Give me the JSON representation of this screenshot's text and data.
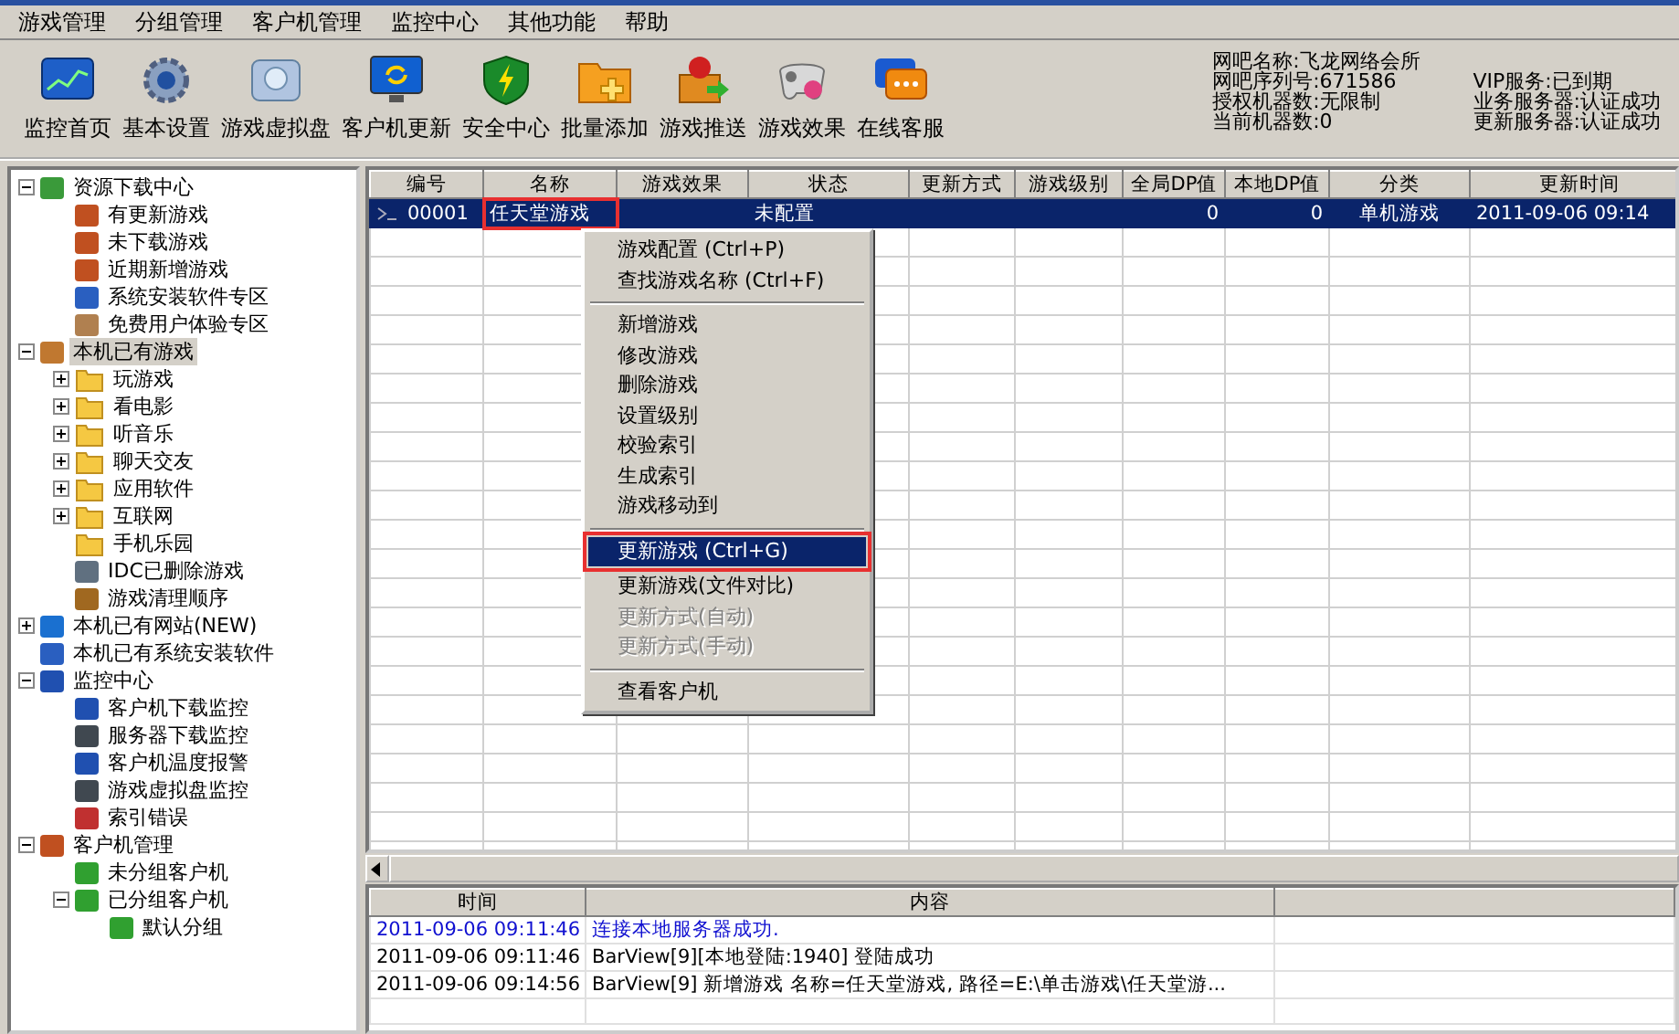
{
  "menu_bar": [
    "游戏管理",
    "分组管理",
    "客户机管理",
    "监控中心",
    "其他功能",
    "帮助"
  ],
  "toolbar": [
    {
      "label": "监控首页"
    },
    {
      "label": "基本设置"
    },
    {
      "label": "游戏虚拟盘"
    },
    {
      "label": "客户机更新"
    },
    {
      "label": "安全中心"
    },
    {
      "label": "批量添加"
    },
    {
      "label": "游戏推送"
    },
    {
      "label": "游戏效果"
    },
    {
      "label": "在线客服"
    }
  ],
  "info_left": [
    "网吧名称:飞龙网络会所",
    "网吧序列号:671586",
    "授权机器数:无限制",
    "当前机器数:0"
  ],
  "info_right": [
    "VIP服务:已到期",
    "业务服务器:认证成功",
    "更新服务器:认证成功"
  ],
  "tree": [
    {
      "label": "资源下载中心",
      "kind": "download",
      "expanded": true,
      "selected": false,
      "children": [
        {
          "label": "有更新游戏",
          "kind": "person",
          "selected": false
        },
        {
          "label": "未下载游戏",
          "kind": "person",
          "selected": false
        },
        {
          "label": "近期新增游戏",
          "kind": "person",
          "selected": false
        },
        {
          "label": "系统安装软件专区",
          "kind": "windows",
          "selected": false
        },
        {
          "label": "免费用户体验专区",
          "kind": "chair",
          "selected": false
        }
      ]
    },
    {
      "label": "本机已有游戏",
      "kind": "box",
      "expanded": true,
      "selected": true,
      "children": [
        {
          "label": "玩游戏",
          "kind": "folder",
          "expanded": false,
          "selected": false
        },
        {
          "label": "看电影",
          "kind": "folder",
          "expanded": false,
          "selected": false
        },
        {
          "label": "听音乐",
          "kind": "folder",
          "expanded": false,
          "selected": false
        },
        {
          "label": "聊天交友",
          "kind": "folder",
          "expanded": false,
          "selected": false
        },
        {
          "label": "应用软件",
          "kind": "folder",
          "expanded": false,
          "selected": false
        },
        {
          "label": "互联网",
          "kind": "folder",
          "expanded": false,
          "selected": false
        },
        {
          "label": "手机乐园",
          "kind": "folder",
          "selected": false
        },
        {
          "label": "IDC已删除游戏",
          "kind": "trash",
          "selected": false
        },
        {
          "label": "游戏清理顺序",
          "kind": "broom",
          "selected": false
        }
      ]
    },
    {
      "label": "本机已有网站(NEW)",
      "kind": "globe",
      "expanded": false,
      "selected": false
    },
    {
      "label": "本机已有系统安装软件",
      "kind": "windows",
      "selected": false
    },
    {
      "label": "监控中心",
      "kind": "monitor",
      "expanded": true,
      "selected": false,
      "children": [
        {
          "label": "客户机下载监控",
          "kind": "monitor",
          "selected": false
        },
        {
          "label": "服务器下载监控",
          "kind": "server",
          "selected": false
        },
        {
          "label": "客户机温度报警",
          "kind": "monitor",
          "selected": false
        },
        {
          "label": "游戏虚拟盘监控",
          "kind": "server",
          "selected": false
        },
        {
          "label": "索引错误",
          "kind": "document",
          "selected": false
        }
      ]
    },
    {
      "label": "客户机管理",
      "kind": "person",
      "expanded": true,
      "selected": false,
      "children": [
        {
          "label": "未分组客户机",
          "kind": "network",
          "selected": false
        },
        {
          "label": "已分组客户机",
          "kind": "network",
          "expanded": true,
          "selected": false,
          "children": [
            {
              "label": "默认分组",
              "kind": "network",
              "selected": false
            }
          ]
        }
      ]
    }
  ],
  "table": {
    "columns": [
      "编号",
      "名称",
      "游戏效果",
      "状态",
      "更新方式",
      "游戏级别",
      "全局DP值",
      "本地DP值",
      "分类",
      "更新时间"
    ],
    "rows": [
      {
        "selected": true,
        "cells": [
          "00001",
          "任天堂游戏",
          null,
          "未配置",
          null,
          null,
          "0",
          "0",
          "单机游戏",
          "2011-09-06 09:14"
        ]
      }
    ]
  },
  "context_menu": [
    {
      "kind": "item",
      "label": "游戏配置 (Ctrl+P)",
      "disabled": false,
      "selected": false
    },
    {
      "kind": "item",
      "label": "查找游戏名称 (Ctrl+F)",
      "disabled": false,
      "selected": false
    },
    {
      "kind": "separator"
    },
    {
      "kind": "item",
      "label": "新增游戏",
      "disabled": false,
      "selected": false
    },
    {
      "kind": "item",
      "label": "修改游戏",
      "disabled": false,
      "selected": false
    },
    {
      "kind": "item",
      "label": "删除游戏",
      "disabled": false,
      "selected": false
    },
    {
      "kind": "item",
      "label": "设置级别",
      "disabled": false,
      "selected": false
    },
    {
      "kind": "item",
      "label": "校验索引",
      "disabled": false,
      "selected": false
    },
    {
      "kind": "item",
      "label": "生成索引",
      "disabled": false,
      "selected": false
    },
    {
      "kind": "item",
      "label": "游戏移动到",
      "disabled": false,
      "selected": false
    },
    {
      "kind": "separator"
    },
    {
      "kind": "item",
      "label": "更新游戏 (Ctrl+G)",
      "disabled": false,
      "selected": true
    },
    {
      "kind": "item",
      "label": "更新游戏(文件对比)",
      "disabled": false,
      "selected": false
    },
    {
      "kind": "item",
      "label": "更新方式(自动)",
      "disabled": true,
      "selected": false
    },
    {
      "kind": "item",
      "label": "更新方式(手动)",
      "disabled": true,
      "selected": false
    },
    {
      "kind": "separator"
    },
    {
      "kind": "item",
      "label": "查看客户机",
      "disabled": false,
      "selected": false
    }
  ],
  "log": {
    "columns": [
      "时间",
      "内容"
    ],
    "rows": [
      {
        "kind": "success",
        "time": "2011-09-06 09:11:46",
        "text": "连接本地服务器成功."
      },
      {
        "kind": "normal",
        "time": "2011-09-06 09:11:46",
        "text": "BarView[9][本地登陆:1940] 登陆成功"
      },
      {
        "kind": "normal",
        "time": "2011-09-06 09:14:56",
        "text": "BarView[9] 新增游戏 名称=任天堂游戏, 路径=E:\\单击游戏\\任天堂游..."
      }
    ]
  }
}
